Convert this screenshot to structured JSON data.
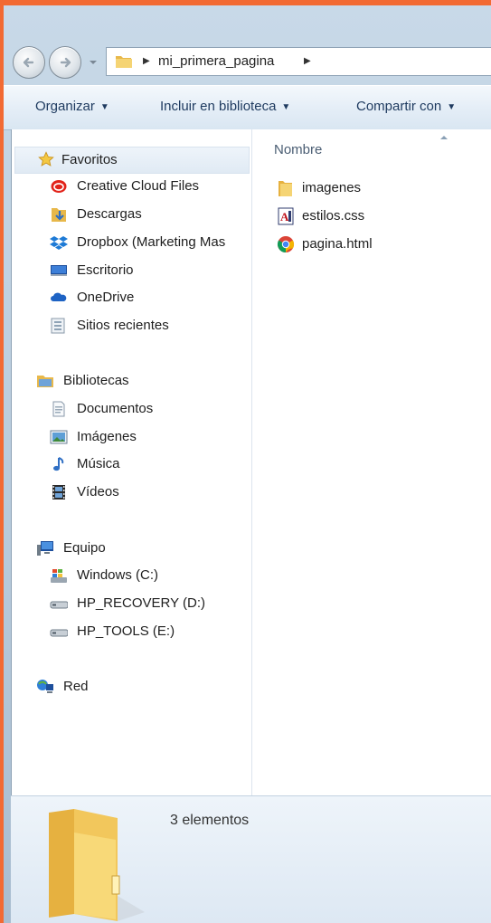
{
  "address": {
    "path": [
      "mi_primera_pagina"
    ]
  },
  "toolbar": {
    "organize": "Organizar",
    "include_library": "Incluir en biblioteca",
    "share_with": "Compartir con"
  },
  "nav": {
    "favorites": {
      "label": "Favoritos",
      "items": [
        {
          "label": "Creative Cloud Files",
          "icon": "creative-cloud-icon"
        },
        {
          "label": "Descargas",
          "icon": "downloads-icon"
        },
        {
          "label": "Dropbox (Marketing Mas",
          "icon": "dropbox-icon"
        },
        {
          "label": "Escritorio",
          "icon": "desktop-icon"
        },
        {
          "label": "OneDrive",
          "icon": "onedrive-icon"
        },
        {
          "label": "Sitios recientes",
          "icon": "recent-places-icon"
        }
      ]
    },
    "libraries": {
      "label": "Bibliotecas",
      "items": [
        {
          "label": "Documentos",
          "icon": "documents-icon"
        },
        {
          "label": "Imágenes",
          "icon": "pictures-icon"
        },
        {
          "label": "Música",
          "icon": "music-icon"
        },
        {
          "label": "Vídeos",
          "icon": "videos-icon"
        }
      ]
    },
    "computer": {
      "label": "Equipo",
      "items": [
        {
          "label": "Windows  (C:)",
          "icon": "windows-drive-icon"
        },
        {
          "label": "HP_RECOVERY (D:)",
          "icon": "drive-icon"
        },
        {
          "label": "HP_TOOLS (E:)",
          "icon": "drive-icon"
        }
      ]
    },
    "network": {
      "label": "Red"
    }
  },
  "content": {
    "column_header": "Nombre",
    "files": [
      {
        "name": "imagenes",
        "icon": "folder-icon"
      },
      {
        "name": "estilos.css",
        "icon": "css-file-icon"
      },
      {
        "name": "pagina.html",
        "icon": "chrome-html-icon"
      }
    ]
  },
  "details": {
    "count": "3 elementos"
  },
  "colors": {
    "frame": "#f26a33",
    "toolbar_text": "#1e3a5f",
    "folder": "#f2c75c"
  }
}
